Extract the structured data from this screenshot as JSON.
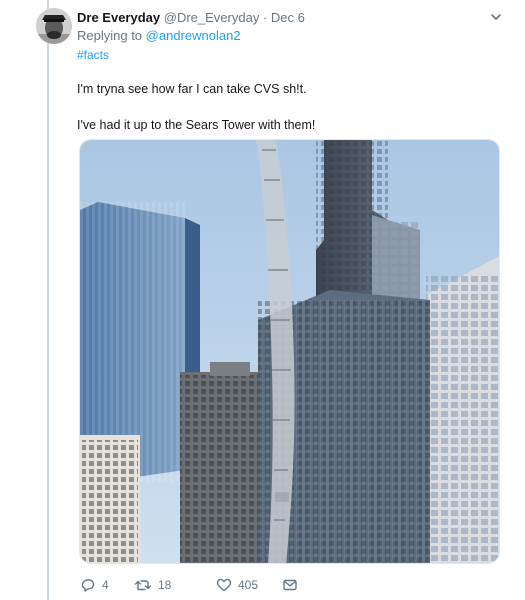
{
  "tweet": {
    "display_name": "Dre Everyday",
    "handle": "@Dre_Everyday",
    "separator": "·",
    "date": "Dec 6",
    "replying_prefix": "Replying to",
    "replying_to": "@andrewnolan2",
    "hashtag": "#facts",
    "text_line_1": "I'm tryna see how far I can take CVS sh!t.",
    "text_line_2": "I've had it up to the Sears Tower with them!",
    "photo_icon": "photo-cvs-receipt-sears-tower"
  },
  "actions": {
    "reply_icon": "reply-icon",
    "reply_count": "4",
    "retweet_icon": "retweet-icon",
    "retweet_count": "18",
    "like_icon": "heart-icon",
    "like_count": "405",
    "dm_icon": "envelope-icon"
  },
  "colors": {
    "link": "#1da1f2",
    "muted": "#657786",
    "thread_line": "#ccd6dd",
    "text": "#14171a"
  }
}
